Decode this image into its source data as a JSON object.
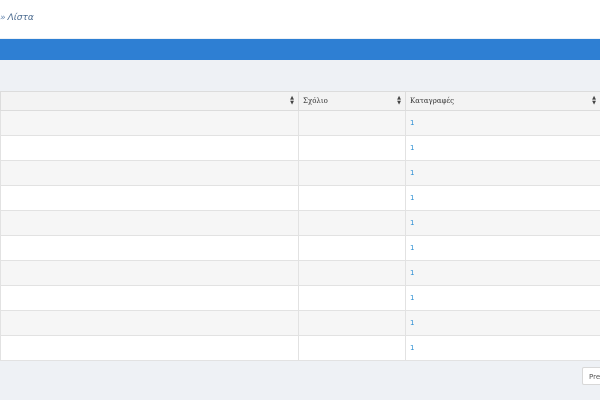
{
  "breadcrumb": {
    "separator": "»",
    "current": "Λίστα"
  },
  "table": {
    "headers": [
      "",
      "Σχόλιο",
      "Καταγραφές"
    ],
    "rows": [
      {
        "col1": "",
        "col2": "",
        "col3": "1"
      },
      {
        "col1": "",
        "col2": "",
        "col3": "1"
      },
      {
        "col1": "",
        "col2": "",
        "col3": "1"
      },
      {
        "col1": "",
        "col2": "",
        "col3": "1"
      },
      {
        "col1": "",
        "col2": "",
        "col3": "1"
      },
      {
        "col1": "",
        "col2": "",
        "col3": "1"
      },
      {
        "col1": "",
        "col2": "",
        "col3": "1"
      },
      {
        "col1": "",
        "col2": "",
        "col3": "1"
      },
      {
        "col1": "",
        "col2": "",
        "col3": "1"
      },
      {
        "col1": "",
        "col2": "",
        "col3": "1"
      }
    ]
  },
  "pagination": {
    "prev_label": "Pre"
  },
  "colors": {
    "header_bar": "#2e7fd3",
    "link": "#2e8fd3",
    "page_bg": "#eef1f5"
  }
}
